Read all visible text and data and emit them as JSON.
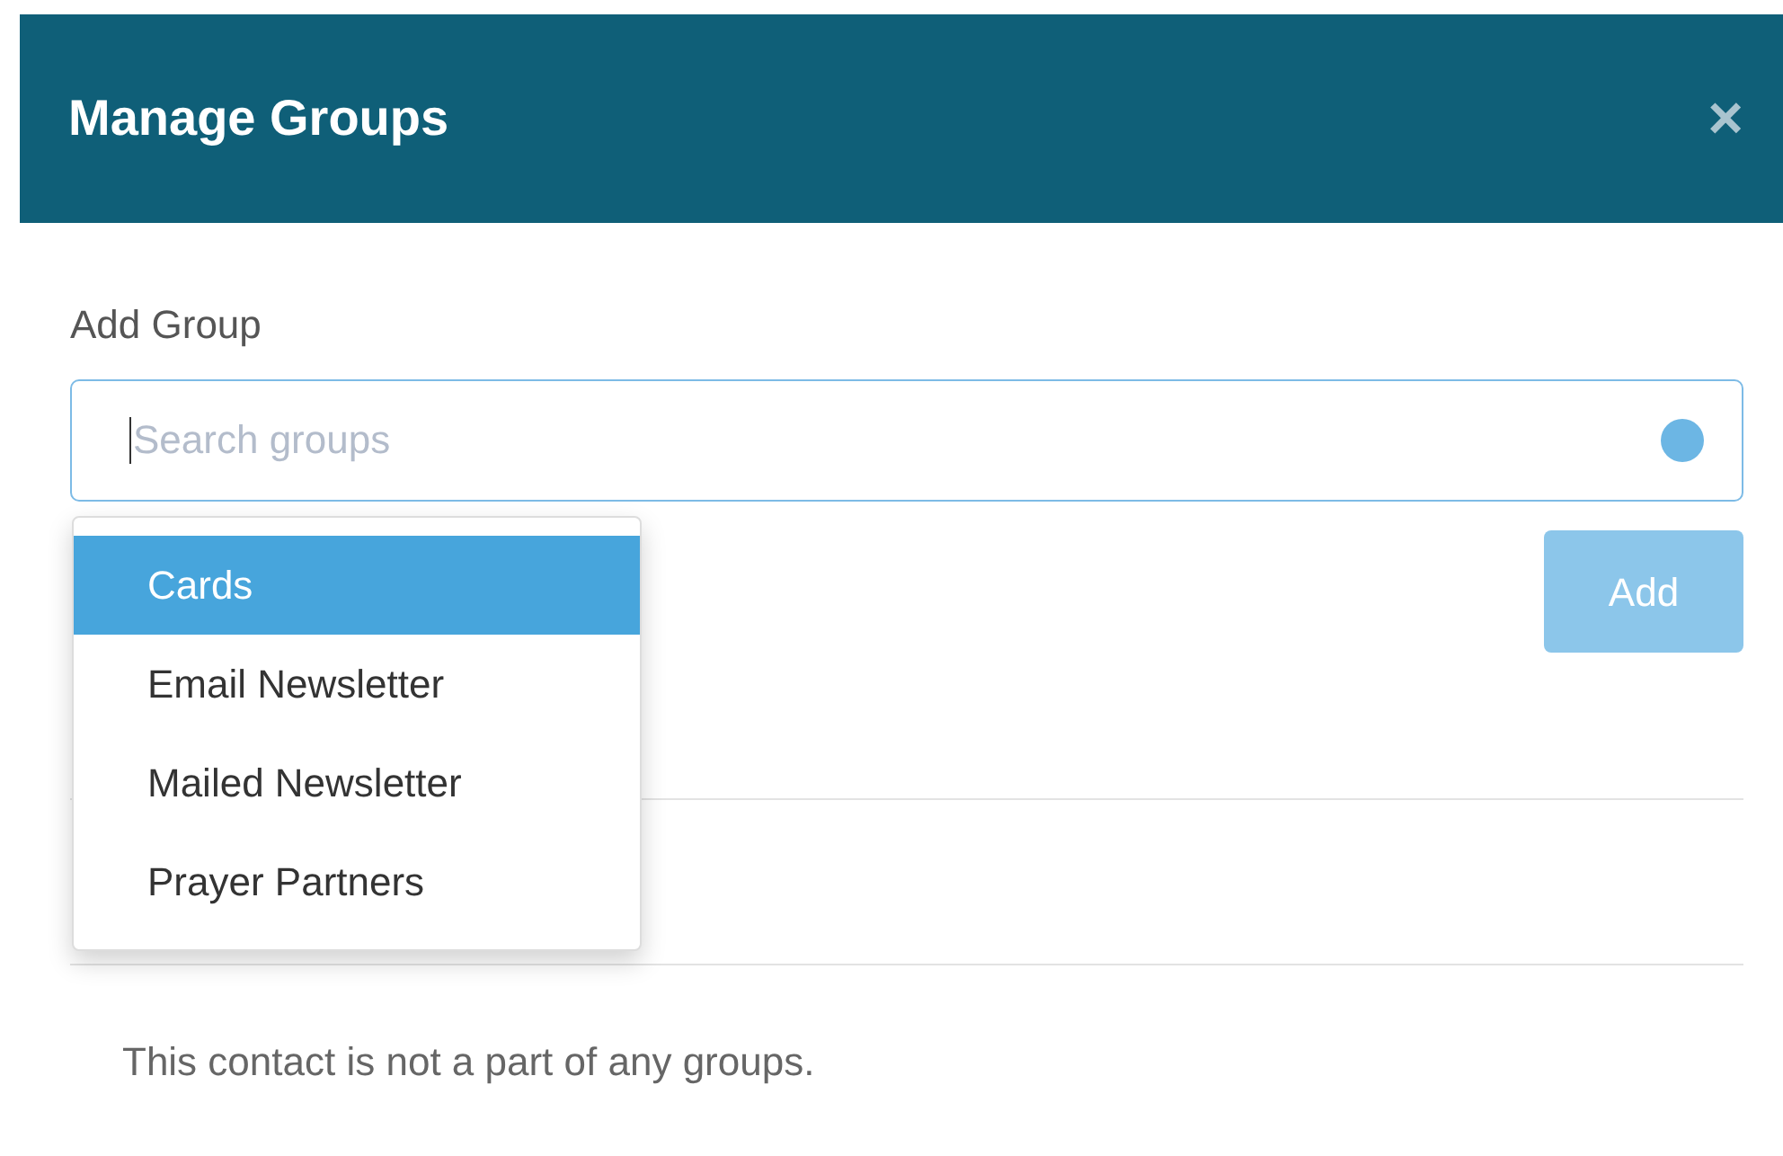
{
  "dialog": {
    "title": "Manage Groups",
    "close": "×"
  },
  "add_group": {
    "label": "Add Group",
    "search": {
      "placeholder": "Search groups",
      "focused": true
    },
    "options": [
      {
        "label": "Cards",
        "selected": true
      },
      {
        "label": "Email Newsletter",
        "selected": false
      },
      {
        "label": "Mailed Newsletter",
        "selected": false
      },
      {
        "label": "Prayer Partners",
        "selected": false
      }
    ],
    "add_button": {
      "label": "Add",
      "disabled": true
    }
  },
  "empty_message": "This contact is not a part of any groups."
}
